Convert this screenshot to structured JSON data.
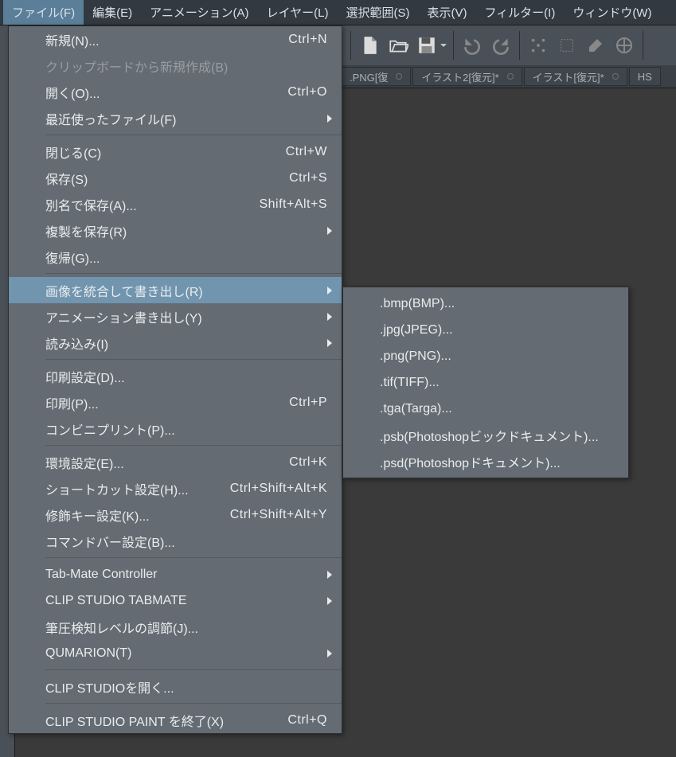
{
  "menubar": [
    {
      "label": "ファイル(F)",
      "active": true
    },
    {
      "label": "編集(E)"
    },
    {
      "label": "アニメーション(A)"
    },
    {
      "label": "レイヤー(L)"
    },
    {
      "label": "選択範囲(S)"
    },
    {
      "label": "表示(V)"
    },
    {
      "label": "フィルター(I)"
    },
    {
      "label": "ウィンドウ(W)"
    }
  ],
  "tabs": [
    {
      "label": ".PNG[復"
    },
    {
      "label": "イラスト2[復元]*"
    },
    {
      "label": "イラスト[復元]*"
    },
    {
      "label": "HS"
    }
  ],
  "file_menu": [
    {
      "label": "新規(N)...",
      "shortcut": "Ctrl+N"
    },
    {
      "label": "クリップボードから新規作成(B)",
      "disabled": true
    },
    {
      "label": "開く(O)...",
      "shortcut": "Ctrl+O"
    },
    {
      "label": "最近使ったファイル(F)",
      "submenu": true
    },
    {
      "sep": true
    },
    {
      "label": "閉じる(C)",
      "shortcut": "Ctrl+W"
    },
    {
      "label": "保存(S)",
      "shortcut": "Ctrl+S"
    },
    {
      "label": "別名で保存(A)...",
      "shortcut": "Shift+Alt+S"
    },
    {
      "label": "複製を保存(R)",
      "submenu": true
    },
    {
      "label": "復帰(G)..."
    },
    {
      "sep": true
    },
    {
      "label": "画像を統合して書き出し(R)",
      "submenu": true,
      "highlight": true
    },
    {
      "label": "アニメーション書き出し(Y)",
      "submenu": true
    },
    {
      "label": "読み込み(I)",
      "submenu": true
    },
    {
      "sep": true
    },
    {
      "label": "印刷設定(D)..."
    },
    {
      "label": "印刷(P)...",
      "shortcut": "Ctrl+P"
    },
    {
      "label": "コンビニプリント(P)..."
    },
    {
      "sep": true
    },
    {
      "label": "環境設定(E)...",
      "shortcut": "Ctrl+K"
    },
    {
      "label": "ショートカット設定(H)...",
      "shortcut": "Ctrl+Shift+Alt+K"
    },
    {
      "label": "修飾キー設定(K)...",
      "shortcut": "Ctrl+Shift+Alt+Y"
    },
    {
      "label": "コマンドバー設定(B)..."
    },
    {
      "sep": true
    },
    {
      "label": "Tab-Mate Controller",
      "submenu": true
    },
    {
      "label": "CLIP STUDIO TABMATE",
      "submenu": true
    },
    {
      "label": "筆圧検知レベルの調節(J)..."
    },
    {
      "label": "QUMARION(T)",
      "submenu": true
    },
    {
      "sep": true
    },
    {
      "label": "CLIP STUDIOを開く..."
    },
    {
      "sep": true
    },
    {
      "label": "CLIP STUDIO PAINT を終了(X)",
      "shortcut": "Ctrl+Q"
    }
  ],
  "export_submenu": [
    {
      "label": ".bmp(BMP)..."
    },
    {
      "label": ".jpg(JPEG)..."
    },
    {
      "label": ".png(PNG)..."
    },
    {
      "label": ".tif(TIFF)..."
    },
    {
      "label": ".tga(Targa)..."
    },
    {
      "label": ".psb(Photoshopビックドキュメント)..."
    },
    {
      "label": ".psd(Photoshopドキュメント)..."
    }
  ]
}
